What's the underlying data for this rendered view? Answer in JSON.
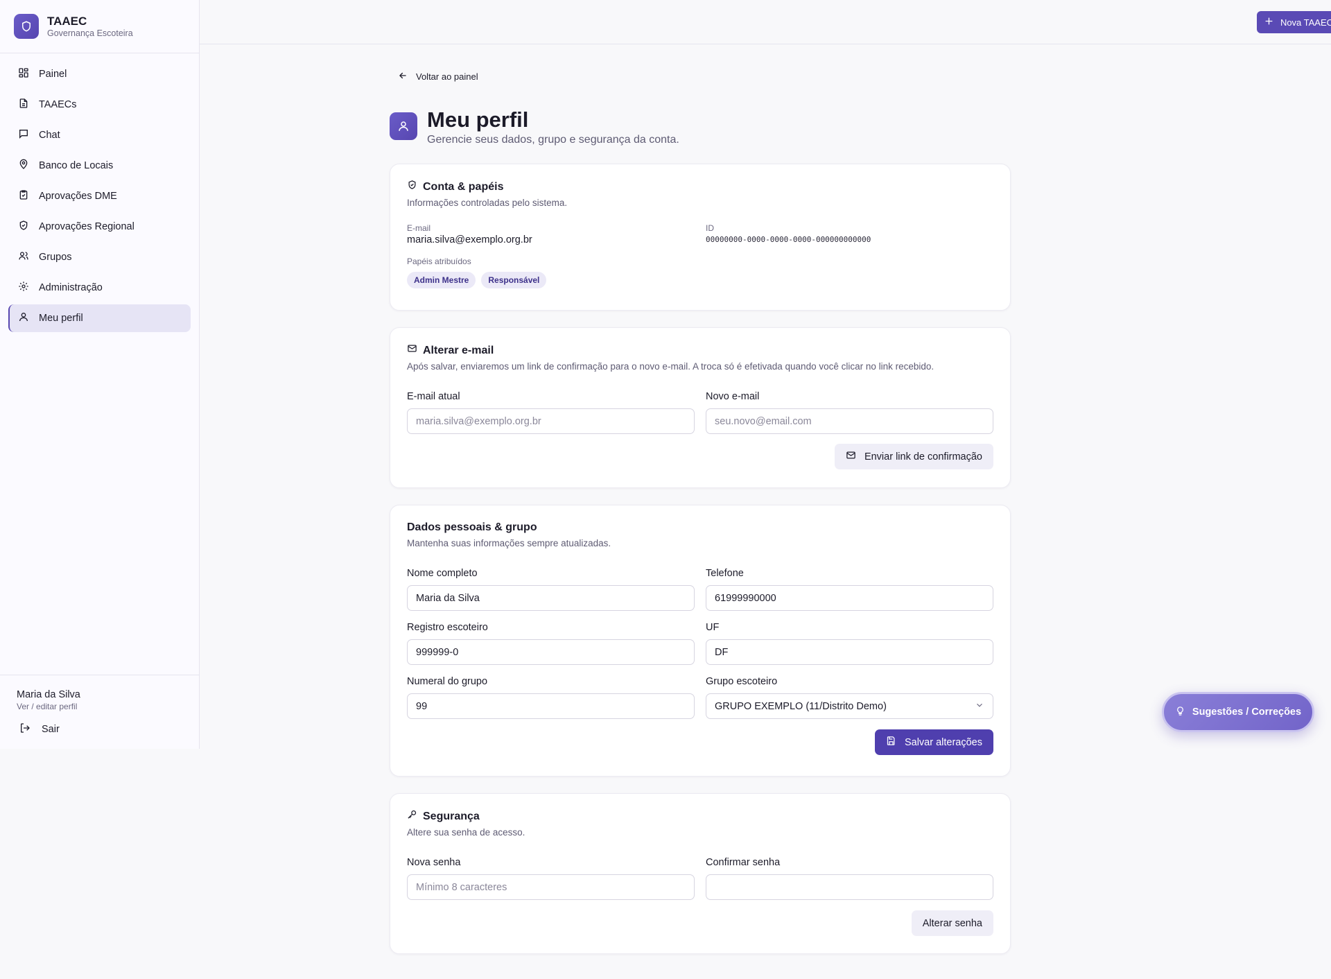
{
  "brand": {
    "title": "TAAEC",
    "subtitle": "Governança Escoteira"
  },
  "nav": [
    {
      "label": "Painel",
      "icon": "dashboard-icon"
    },
    {
      "label": "TAAECs",
      "icon": "document-icon"
    },
    {
      "label": "Chat",
      "icon": "chat-icon"
    },
    {
      "label": "Banco de Locais",
      "icon": "map-pin-icon"
    },
    {
      "label": "Aprovações DME",
      "icon": "clipboard-check-icon"
    },
    {
      "label": "Aprovações Regional",
      "icon": "shield-check-icon"
    },
    {
      "label": "Grupos",
      "icon": "users-icon"
    },
    {
      "label": "Administração",
      "icon": "gear-icon"
    },
    {
      "label": "Meu perfil",
      "icon": "user-icon",
      "active": true
    }
  ],
  "footer": {
    "user_name": "Maria da Silva",
    "user_link": "Ver / editar perfil",
    "logout": "Sair"
  },
  "topbar": {
    "new_button": "Nova TAAEC"
  },
  "page": {
    "back": "Voltar ao painel",
    "title": "Meu perfil",
    "subtitle": "Gerencie seus dados, grupo e segurança da conta."
  },
  "account": {
    "title": "Conta & papéis",
    "desc": "Informações controladas pelo sistema.",
    "email_label": "E-mail",
    "email_value": "maria.silva@exemplo.org.br",
    "id_label": "ID",
    "id_value": "00000000-0000-0000-0000-000000000000",
    "roles_label": "Papéis atribuídos",
    "roles": [
      "Admin Mestre",
      "Responsável"
    ]
  },
  "email_change": {
    "title": "Alterar e-mail",
    "desc": "Após salvar, enviaremos um link de confirmação para o novo e-mail. A troca só é efetivada quando você clicar no link recebido.",
    "current_label": "E-mail atual",
    "current_value": "maria.silva@exemplo.org.br",
    "new_label": "Novo e-mail",
    "new_placeholder": "seu.novo@email.com",
    "button": "Enviar link de confirmação"
  },
  "personal": {
    "title": "Dados pessoais & grupo",
    "desc": "Mantenha suas informações sempre atualizadas.",
    "name_label": "Nome completo",
    "name_value": "Maria da Silva",
    "phone_label": "Telefone",
    "phone_value": "61999990000",
    "registry_label": "Registro escoteiro",
    "registry_value": "999999-0",
    "uf_label": "UF",
    "uf_value": "DF",
    "numeral_label": "Numeral do grupo",
    "numeral_value": "99",
    "group_label": "Grupo escoteiro",
    "group_value": "GRUPO EXEMPLO (11/Distrito Demo)",
    "button": "Salvar alterações"
  },
  "security": {
    "title": "Segurança",
    "desc": "Altere sua senha de acesso.",
    "new_label": "Nova senha",
    "new_placeholder": "Mínimo 8 caracteres",
    "confirm_label": "Confirmar senha",
    "confirm_placeholder": "",
    "button": "Alterar senha"
  },
  "fab": {
    "label": "Sugestões / Correções"
  },
  "colors": {
    "accent": "#5a4ab5",
    "accent_soft": "#ebe9f7",
    "background": "#f8f8fa"
  }
}
